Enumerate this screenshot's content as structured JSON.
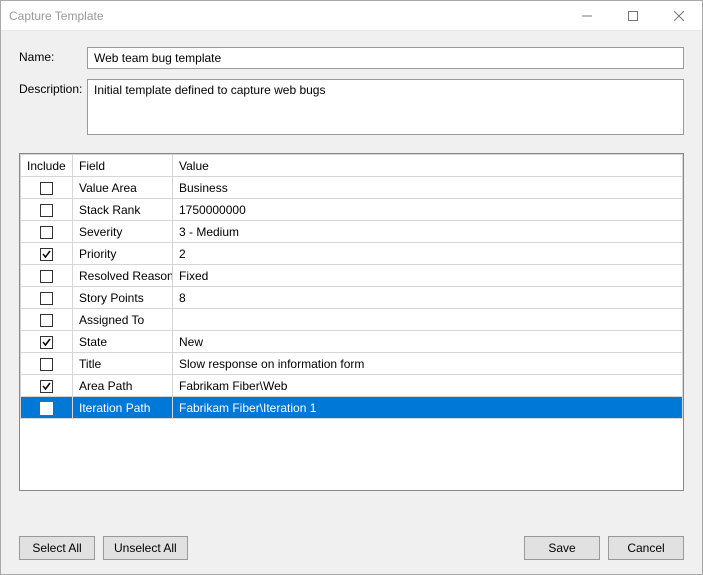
{
  "window": {
    "title": "Capture Template"
  },
  "form": {
    "name_label": "Name:",
    "name_value": "Web team bug template",
    "description_label": "Description:",
    "description_value": "Initial template defined to capture web bugs"
  },
  "grid": {
    "headers": {
      "include": "Include",
      "field": "Field",
      "value": "Value"
    },
    "rows": [
      {
        "include": false,
        "field": "Value Area",
        "value": "Business",
        "selected": false
      },
      {
        "include": false,
        "field": "Stack Rank",
        "value": "1750000000",
        "selected": false
      },
      {
        "include": false,
        "field": "Severity",
        "value": "3 - Medium",
        "selected": false
      },
      {
        "include": true,
        "field": "Priority",
        "value": "2",
        "selected": false
      },
      {
        "include": false,
        "field": "Resolved Reason",
        "value": "Fixed",
        "selected": false
      },
      {
        "include": false,
        "field": "Story Points",
        "value": "8",
        "selected": false
      },
      {
        "include": false,
        "field": "Assigned To",
        "value": "",
        "selected": false
      },
      {
        "include": true,
        "field": "State",
        "value": "New",
        "selected": false
      },
      {
        "include": false,
        "field": "Title",
        "value": "Slow response on information form",
        "selected": false
      },
      {
        "include": true,
        "field": "Area Path",
        "value": "Fabrikam Fiber\\Web",
        "selected": false
      },
      {
        "include": false,
        "field": "Iteration Path",
        "value": "Fabrikam Fiber\\Iteration 1",
        "selected": true
      }
    ]
  },
  "buttons": {
    "select_all": "Select All",
    "unselect_all": "Unselect All",
    "save": "Save",
    "cancel": "Cancel"
  }
}
